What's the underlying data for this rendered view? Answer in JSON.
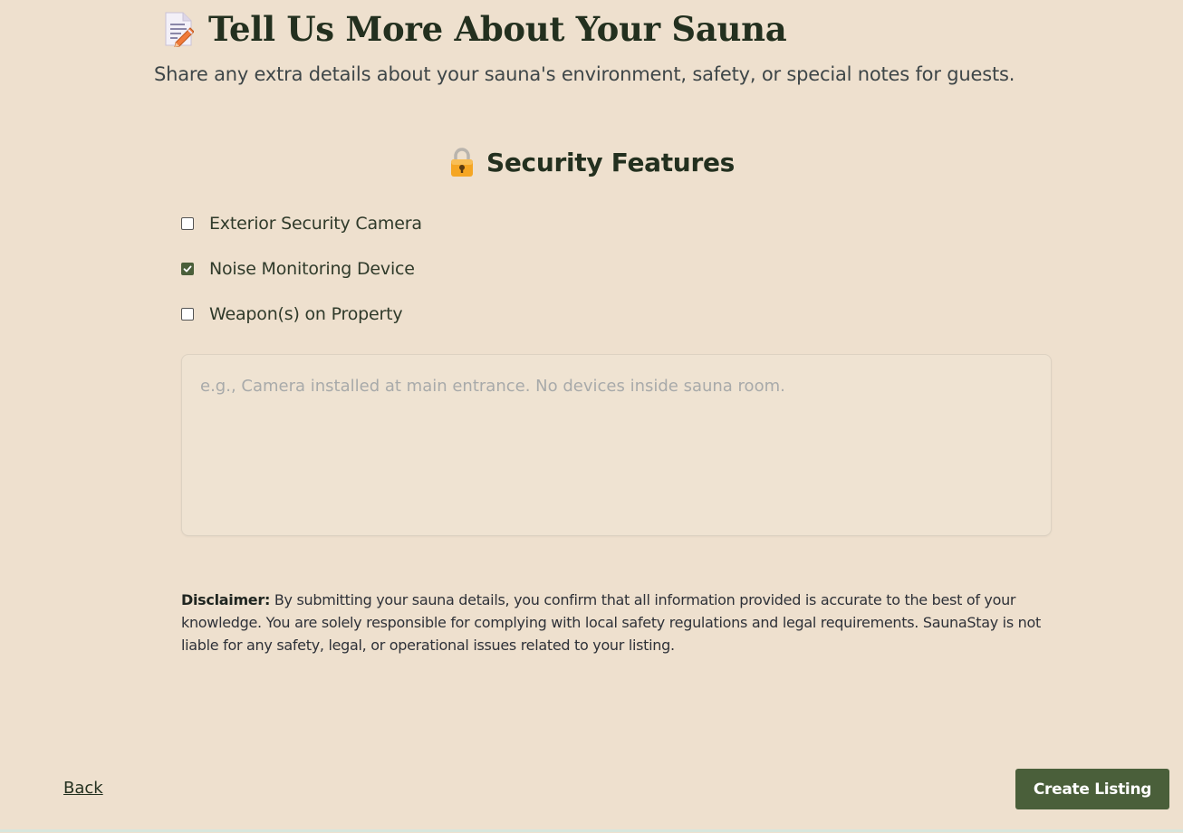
{
  "header": {
    "title": "Tell Us More About Your Sauna",
    "title_icon": "memo-icon",
    "subtitle": "Share any extra details about your sauna's environment, safety, or special notes for guests."
  },
  "security": {
    "title": "Security Features",
    "title_icon": "lock-icon",
    "options": [
      {
        "label": "Exterior Security Camera",
        "checked": false
      },
      {
        "label": "Noise Monitoring Device",
        "checked": true
      },
      {
        "label": "Weapon(s) on Property",
        "checked": false
      }
    ],
    "notes_placeholder": "e.g., Camera installed at main entrance. No devices inside sauna room.",
    "notes_value": ""
  },
  "disclaimer": {
    "label": "Disclaimer:",
    "text": " By submitting your sauna details, you confirm that all information provided is accurate to the best of your knowledge. You are solely responsible for complying with local safety regulations and legal requirements. SaunaStay is not liable for any safety, legal, or operational issues related to your listing."
  },
  "footer": {
    "back_label": "Back",
    "create_label": "Create Listing"
  },
  "colors": {
    "background": "#eee0ce",
    "accent": "#4a5f3a",
    "heading": "#23301f"
  }
}
